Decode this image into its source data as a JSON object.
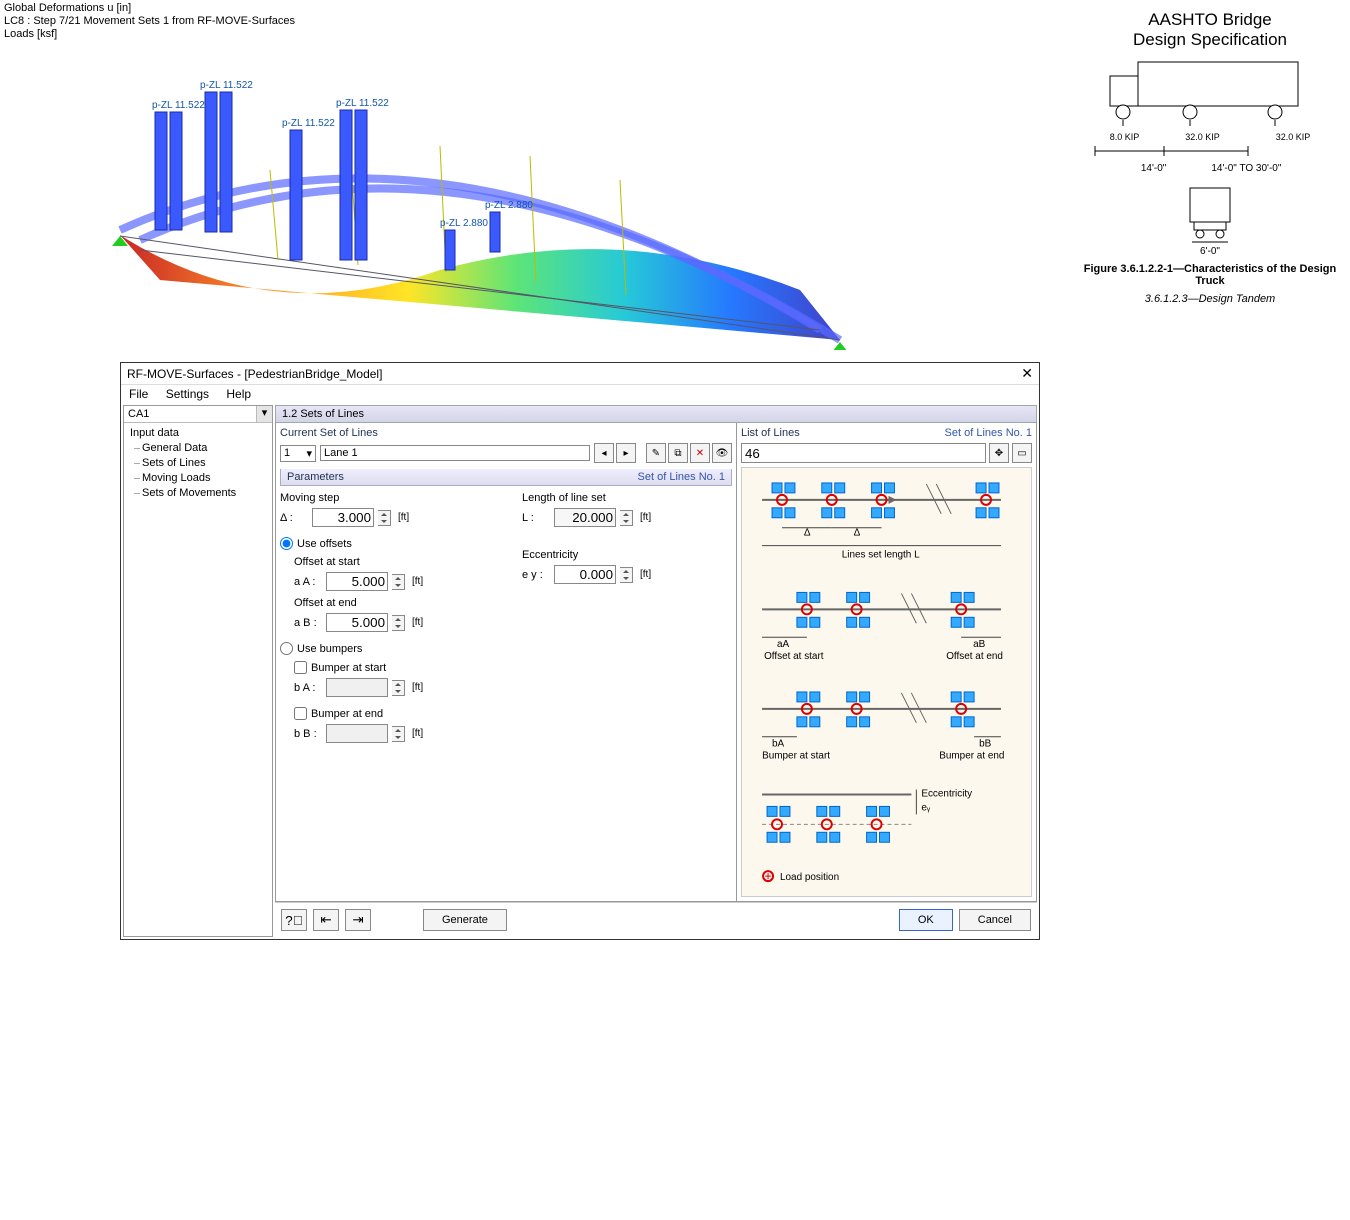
{
  "top": {
    "line1": "Global Deformations u [in]",
    "line2": "LC8 : Step 7/21 Movement Sets 1 from RF-MOVE-Surfaces",
    "line3": "Loads [ksf]"
  },
  "spec": {
    "title1": "AASHTO Bridge",
    "title2": "Design Specification",
    "axle1": "8.0 KIP",
    "axle2": "32.0 KIP",
    "axle3": "32.0 KIP",
    "dim1": "14'-0\"",
    "dim2": "14'-0\"  TO  30'-0\"",
    "width": "6'-0\"",
    "caption": "Figure 3.6.1.2.2-1—Characteristics of the Design Truck",
    "subcaption": "3.6.1.2.3—Design Tandem"
  },
  "loads": {
    "pzl1": "p-ZL 11.522",
    "pzl2": "p-ZL 11.522",
    "pzl3": "p-ZL 11.522",
    "pzl4": "p-ZL 11.522",
    "pzl5": "p-ZL 2.880",
    "pzl6": "p-ZL 2.880"
  },
  "dialog": {
    "title": "RF-MOVE-Surfaces - [PedestrianBridge_Model]",
    "close": "✕",
    "menu": {
      "file": "File",
      "settings": "Settings",
      "help": "Help"
    },
    "nav": {
      "combo": "CA1",
      "root": "Input data",
      "items": [
        "General Data",
        "Sets of Lines",
        "Moving Loads",
        "Sets of Movements"
      ]
    },
    "section_title": "1.2 Sets of Lines",
    "cur_set_h": "Current Set of Lines",
    "set_id": "1",
    "lane_name": "Lane 1",
    "params_h": "Parameters",
    "params_r": "Set of Lines No. 1",
    "moving_step_l": "Moving step",
    "delta_l": "Δ :",
    "delta_v": "3.000",
    "ft": "[ft]",
    "len_l": "Length of line set",
    "len_sym": "L :",
    "len_v": "20.000",
    "ecc_l": "Eccentricity",
    "ey_sym": "e y :",
    "ey_v": "0.000",
    "use_offsets": "Use offsets",
    "off_start_l": "Offset at start",
    "aA_sym": "a A :",
    "aA_v": "5.000",
    "off_end_l": "Offset at end",
    "aB_sym": "a B :",
    "aB_v": "5.000",
    "use_bumpers": "Use bumpers",
    "bump_start": "Bumper at start",
    "bA_sym": "b A :",
    "bump_end": "Bumper at end",
    "bB_sym": "b B :",
    "list_lines_h": "List of Lines",
    "list_lines_r": "Set of Lines No. 1",
    "lines_val": "46",
    "legend_delta": "Δ",
    "legend_L": "Lines set length L",
    "legend_aA": "aA",
    "legend_aB": "aB",
    "legend_offstart": "Offset at start",
    "legend_offend": "Offset at end",
    "legend_bA": "bA",
    "legend_bB": "bB",
    "legend_bumpstart": "Bumper at start",
    "legend_bumpend": "Bumper at end",
    "legend_ecc": "Eccentricity",
    "legend_ey": "eᵧ",
    "legend_loadpos": "Load position",
    "btn_generate": "Generate",
    "btn_ok": "OK",
    "btn_cancel": "Cancel"
  }
}
